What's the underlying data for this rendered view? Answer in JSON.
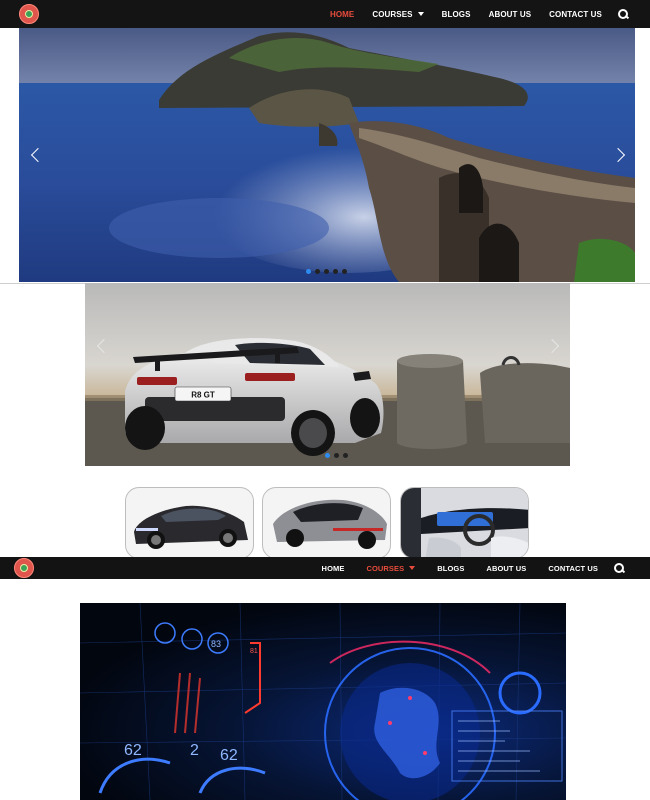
{
  "nav_top": {
    "items": [
      {
        "label": "HOME",
        "active": true,
        "dropdown": false
      },
      {
        "label": "COURSES",
        "active": false,
        "dropdown": true
      },
      {
        "label": "BLOGS",
        "active": false,
        "dropdown": false
      },
      {
        "label": "ABOUT US",
        "active": false,
        "dropdown": false
      },
      {
        "label": "CONTACT US",
        "active": false,
        "dropdown": false
      }
    ],
    "search_icon": "search-icon"
  },
  "slider1": {
    "dots": 5,
    "active_dot": 0,
    "image": "coastal-stone-bridge"
  },
  "slider2": {
    "dots": 3,
    "active_dot": 0,
    "image": "silver-sports-car",
    "plate": "R8 GT"
  },
  "thumbnails": [
    "black-sedan-front",
    "grey-sedan-rear",
    "car-interior-dashboard"
  ],
  "nav_mid": {
    "items": [
      {
        "label": "HOME",
        "active": false,
        "dropdown": false
      },
      {
        "label": "COURSES",
        "active": true,
        "dropdown": true
      },
      {
        "label": "BLOGS",
        "active": false,
        "dropdown": false
      },
      {
        "label": "ABOUT US",
        "active": false,
        "dropdown": false
      },
      {
        "label": "CONTACT US",
        "active": false,
        "dropdown": false
      }
    ]
  },
  "hero3": {
    "image": "futuristic-hud-globe",
    "hud_numbers": [
      "62",
      "2",
      "62",
      "83",
      "81"
    ]
  },
  "colors": {
    "nav_bg": "#141414",
    "active": "#e74c3c",
    "dot_active": "#2d8cf0"
  }
}
